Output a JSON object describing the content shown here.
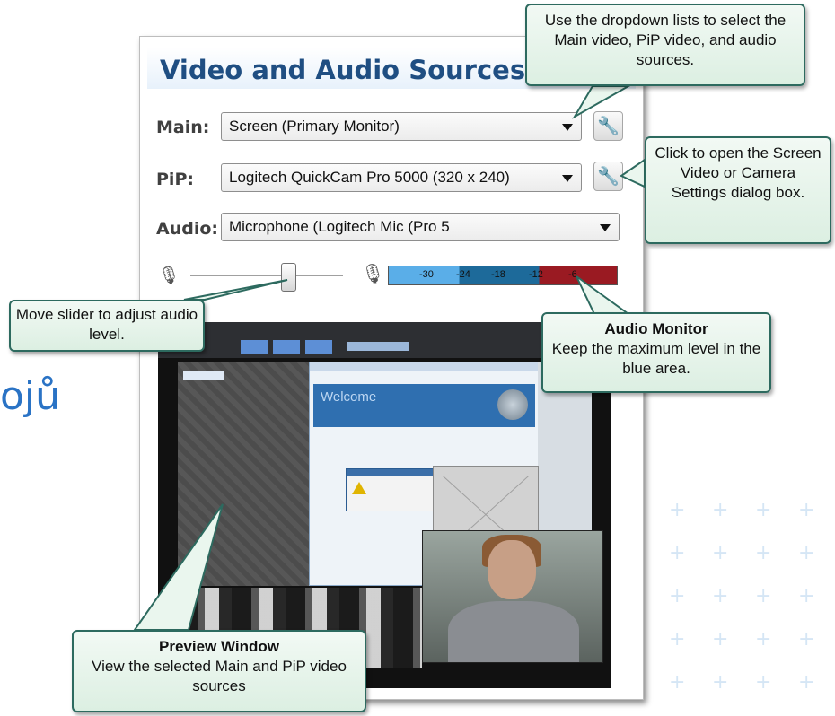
{
  "background": {
    "partial_text": "ojů"
  },
  "panel": {
    "title": "Video and Audio Sources",
    "main": {
      "label": "Main:",
      "value": "Screen (Primary Monitor)"
    },
    "pip": {
      "label": "PiP:",
      "value": "Logitech QuickCam Pro 5000 (320 x 240)"
    },
    "audio": {
      "label": "Audio:",
      "value": "Microphone (Logitech Mic (Pro 5"
    },
    "audio_level_fraction": 0.64,
    "meter_ticks": [
      "-30",
      "-24",
      "-18",
      "-12",
      "-6"
    ]
  },
  "callouts": {
    "dropdown": "Use the dropdown lists to select the Main video, PiP video, and audio sources.",
    "settings": "Click to open the Screen Video or Camera Settings dialog box.",
    "slider": "Move slider to adjust audio level.",
    "audio_monitor": {
      "title": "Audio Monitor",
      "text": "Keep the maximum level in the blue area."
    },
    "preview": {
      "title": "Preview Window",
      "text": "View the selected Main and PiP video sources"
    }
  },
  "colors": {
    "title": "#1f4e82",
    "callout_border": "#2d6a5f",
    "meter_blue": "#5aaee8",
    "meter_dark": "#1d6a9a",
    "meter_red": "#9a1a22"
  },
  "icons": [
    "wrench-icon",
    "microphone-icon",
    "microphone-loud-icon",
    "dropdown-arrow-icon"
  ]
}
